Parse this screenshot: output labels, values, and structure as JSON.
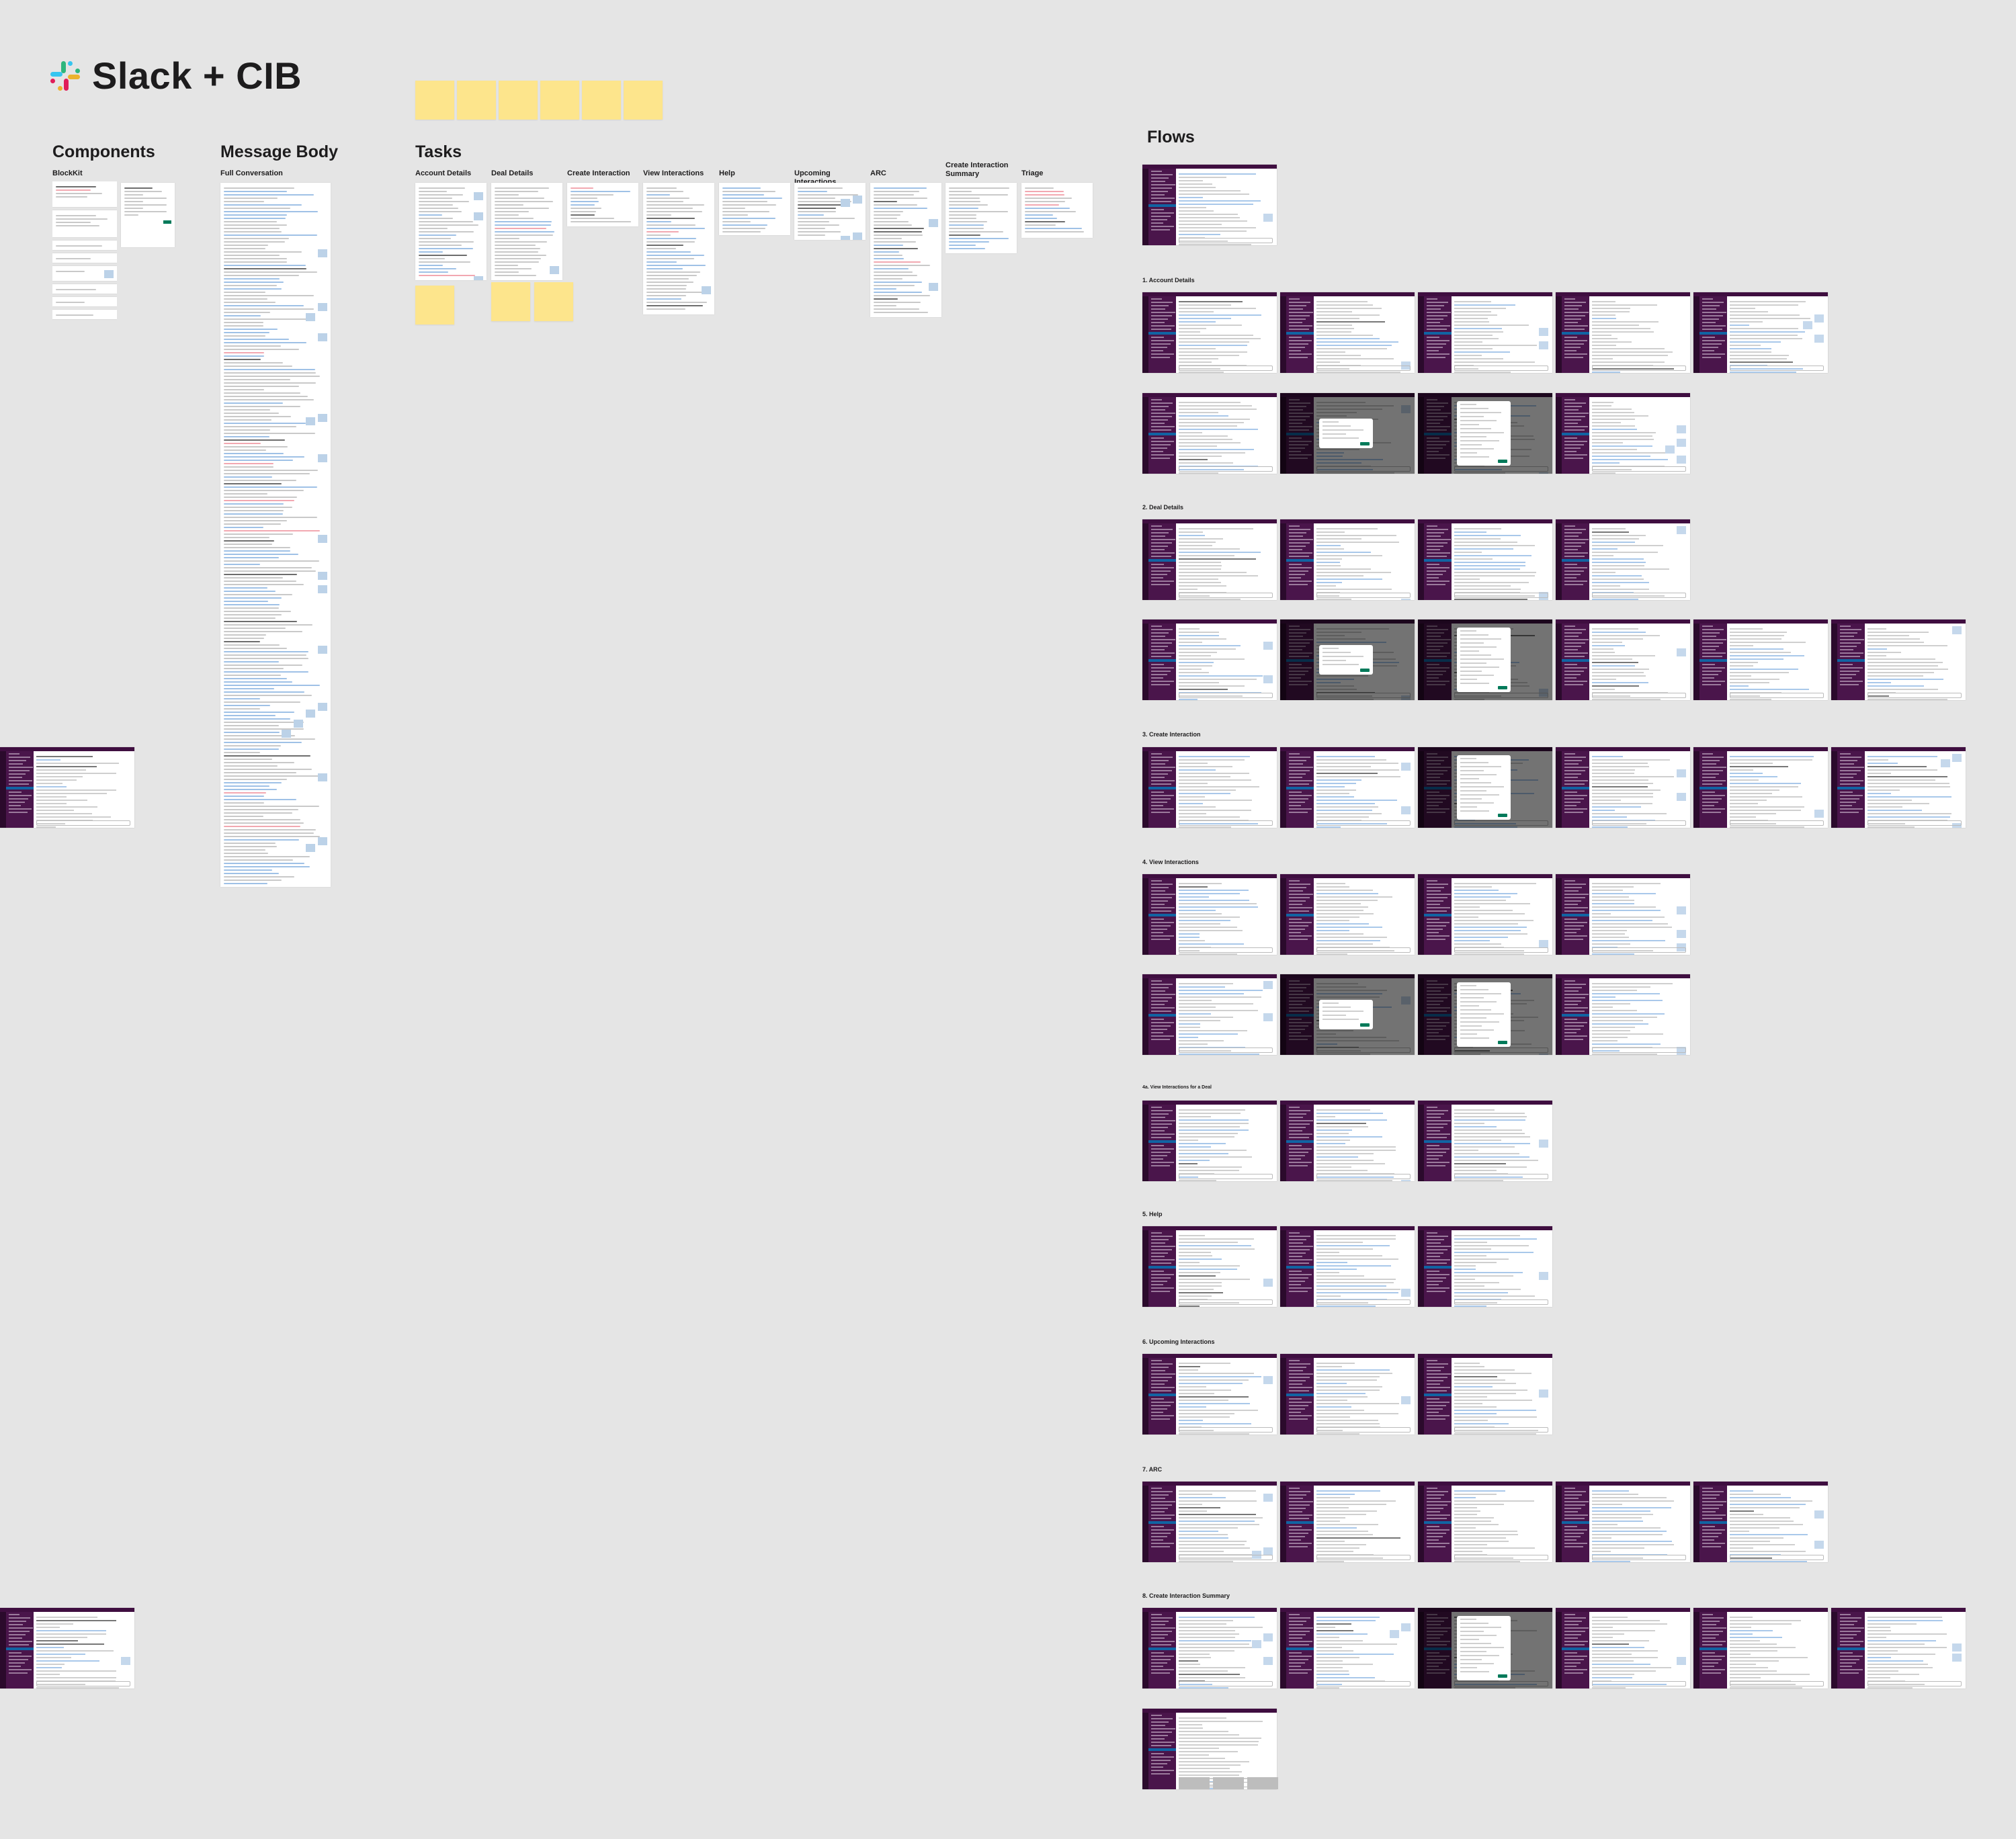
{
  "title": "Slack + CIB",
  "brand_colors": {
    "slack_purple": "#4a154b",
    "slack_green": "#007a5a",
    "sticky_yellow": "#fde58c"
  },
  "components": {
    "heading": "Components",
    "blockkit_label": "BlockKit"
  },
  "message_body": {
    "heading": "Message Body",
    "full_conversation_label": "Full Conversation"
  },
  "tasks": {
    "heading": "Tasks",
    "columns": [
      "Account Details",
      "Deal Details",
      "Create Interaction",
      "View Interactions",
      "Help",
      "Upcoming Interactions",
      "ARC",
      "Create Interaction Summary",
      "Triage"
    ]
  },
  "flows": {
    "heading": "Flows",
    "sections": [
      "1. Account Details",
      "2. Deal Details",
      "3. Create Interaction",
      "4. View Interactions",
      "4a. View Interactions for a Deal",
      "5. Help",
      "6. Upcoming Interactions",
      "7. ARC",
      "8. Create Interaction Summary"
    ]
  }
}
